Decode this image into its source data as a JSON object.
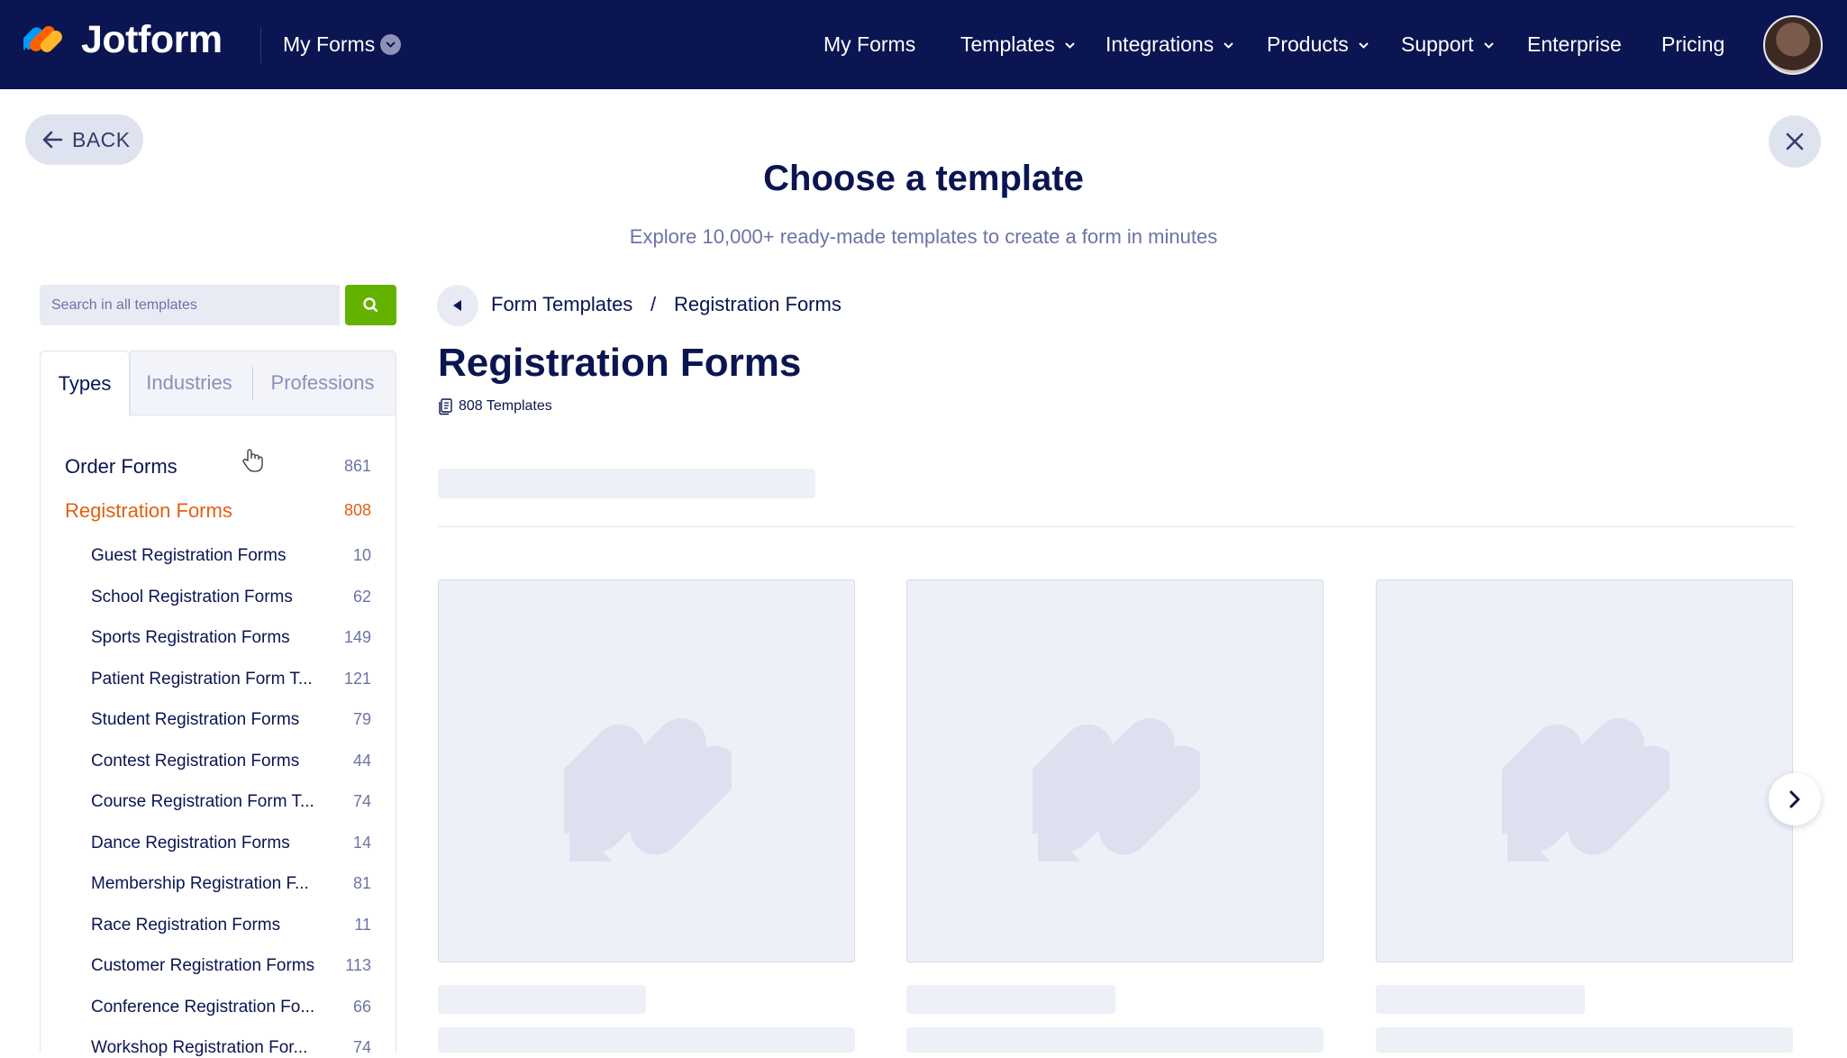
{
  "topbar": {
    "brand": "Jotform",
    "my_forms_dropdown": "My Forms",
    "nav": [
      {
        "label": "My Forms"
      },
      {
        "label": "Templates"
      },
      {
        "label": "Integrations"
      },
      {
        "label": "Products"
      },
      {
        "label": "Support"
      },
      {
        "label": "Enterprise"
      },
      {
        "label": "Pricing"
      }
    ],
    "avatar_icon": "user-avatar"
  },
  "header": {
    "back_label": "BACK",
    "title": "Choose a template",
    "subtitle": "Explore 10,000+ ready-made templates to create a form in minutes"
  },
  "sidebar": {
    "search_placeholder": "Search in all templates",
    "tabs": [
      {
        "label": "Types"
      },
      {
        "label": "Industries"
      },
      {
        "label": "Professions"
      }
    ],
    "categories": [
      {
        "label": "Order Forms",
        "count": "861"
      },
      {
        "label": "Registration Forms",
        "count": "808"
      }
    ],
    "subcategories": [
      {
        "label": "Guest Registration Forms",
        "count": "10"
      },
      {
        "label": "School Registration Forms",
        "count": "62"
      },
      {
        "label": "Sports Registration Forms",
        "count": "149"
      },
      {
        "label": "Patient Registration Form T...",
        "count": "121"
      },
      {
        "label": "Student Registration Forms",
        "count": "79"
      },
      {
        "label": "Contest Registration Forms",
        "count": "44"
      },
      {
        "label": "Course Registration Form T...",
        "count": "74"
      },
      {
        "label": "Dance Registration Forms",
        "count": "14"
      },
      {
        "label": "Membership Registration F...",
        "count": "81"
      },
      {
        "label": "Race Registration Forms",
        "count": "11"
      },
      {
        "label": "Customer Registration Forms",
        "count": "113"
      },
      {
        "label": "Conference Registration Fo...",
        "count": "66"
      },
      {
        "label": "Workshop Registration For...",
        "count": "74"
      }
    ]
  },
  "main": {
    "breadcrumb": [
      "Form Templates",
      "/",
      "Registration Forms"
    ],
    "title": "Registration Forms",
    "template_count": "808 Templates"
  },
  "colors": {
    "navy": "#0a1551",
    "accent_orange": "#e0610e",
    "search_green": "#64b200",
    "skeleton": "#eef0f8"
  }
}
